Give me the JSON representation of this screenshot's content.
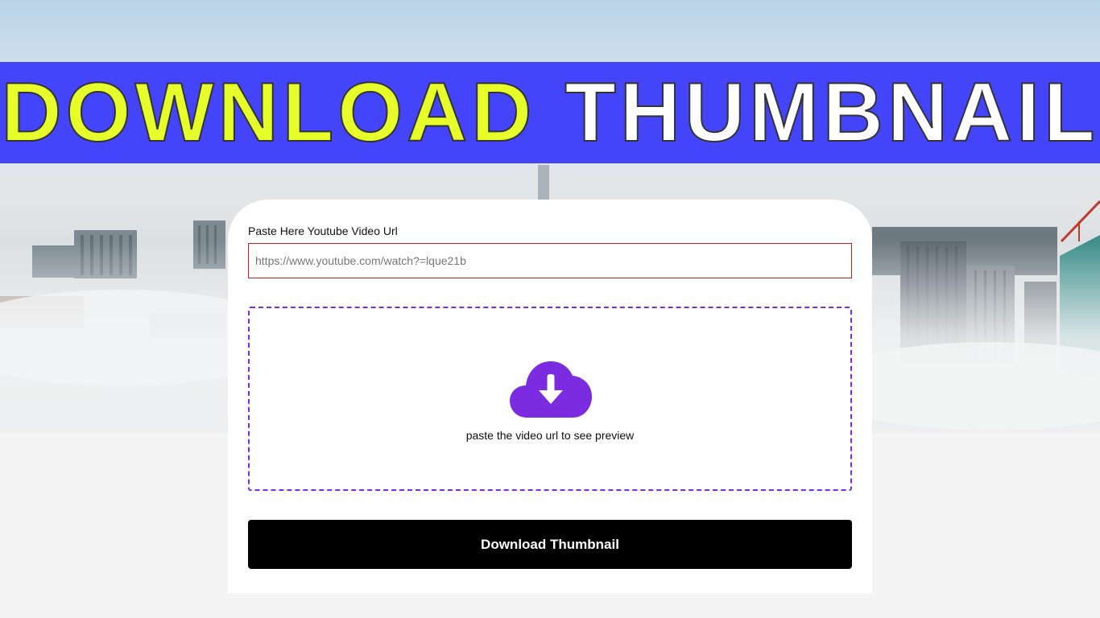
{
  "banner": {
    "word1": "DOWNLOAD",
    "word2": "THUMBNAIL",
    "background_color": "#4444fb",
    "word1_color": "#e6ff2a",
    "word2_color": "#ffffff"
  },
  "hero": {
    "background": "city-skyline-in-fog"
  },
  "form": {
    "url_label": "Paste Here Youtube Video Url",
    "url_value": "",
    "url_placeholder": "https://www.youtube.com/watch?=lque21b",
    "input_border_color": "#d11b1b"
  },
  "preview": {
    "icon": "cloud-download-icon",
    "icon_color": "#7b2be0",
    "message": "paste the video url to see preview"
  },
  "actions": {
    "download_label": "Download Thumbnail"
  }
}
